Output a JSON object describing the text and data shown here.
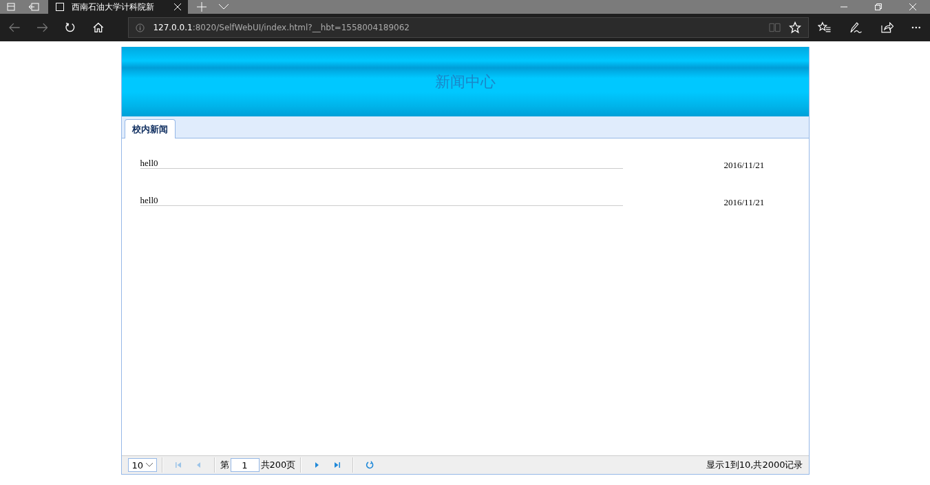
{
  "browser": {
    "tab_title": "西南石油大学计科院新",
    "url_host": "127.0.0.1",
    "url_rest": ":8020/SelfWebUI/index.html?__hbt=1558004189062"
  },
  "header": {
    "title": "新闻中心"
  },
  "tabs": [
    {
      "label": "校内新闻",
      "selected": true
    }
  ],
  "news": [
    {
      "title": "hell0",
      "date": "2016/11/21"
    },
    {
      "title": "hell0",
      "date": "2016/11/21"
    }
  ],
  "pager": {
    "page_size": "10",
    "page_prefix": "第",
    "page": "1",
    "page_suffix": "共200页",
    "summary": "显示1到10,共2000记录"
  }
}
